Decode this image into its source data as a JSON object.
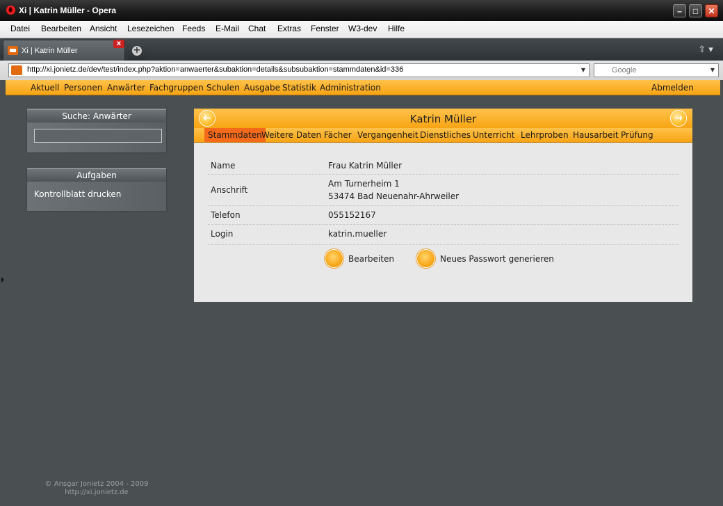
{
  "window": {
    "title": "Xi | Katrin Müller - Opera",
    "minimize": "–",
    "maximize": "□",
    "close": "✕"
  },
  "menu": [
    "Datei",
    "Bearbeiten",
    "Ansicht",
    "Lesezeichen",
    "Feeds",
    "E-Mail",
    "Chat",
    "Extras",
    "Fenster",
    "W3-dev",
    "Hilfe"
  ],
  "tab": {
    "label": "Xi | Katrin Müller",
    "close": "x",
    "newtab": "+",
    "menu": "⇧ ▾"
  },
  "address": {
    "url": "http://xi.jonietz.de/dev/test/index.php?aktion=anwaerter&subaktion=details&subsubaktion=stammdaten&id=336",
    "search_placeholder": "Google",
    "dropdown": "▼"
  },
  "sitenav": {
    "items": [
      "Aktuell",
      "Personen",
      "Anwärter",
      "Fachgruppen",
      "Schulen",
      "Ausgabe",
      "Statistik",
      "Administration"
    ],
    "logout": "Abmelden"
  },
  "search_panel": {
    "title": "Suche: Anwärter",
    "value": ""
  },
  "tasks_panel": {
    "title": "Aufgaben",
    "link": "Kontrollblatt drucken"
  },
  "person": {
    "name": "Katrin Müller",
    "prev": "←",
    "next": "→",
    "tabs": [
      "Stammdaten",
      "Weitere Daten",
      "Fächer",
      "Vergangenheit",
      "Dienstliches",
      "Unterricht",
      "Lehrproben",
      "Hausarbeit",
      "Prüfung"
    ],
    "active_tab": "Stammdaten",
    "fields": [
      {
        "label": "Name",
        "value": "Frau Katrin Müller"
      },
      {
        "label": "Anschrift",
        "value": "Am Turnerheim 1",
        "value2": "53474 Bad Neuenahr-Ahrweiler"
      },
      {
        "label": "Telefon",
        "value": "055152167"
      },
      {
        "label": "Login",
        "value": "katrin.mueller"
      }
    ],
    "buttons": [
      "Bearbeiten",
      "Neues Passwort generieren"
    ]
  },
  "footer": {
    "copyright": "© Ansgar Jonietz 2004 - 2009",
    "url": "http://xi.jonietz.de"
  }
}
